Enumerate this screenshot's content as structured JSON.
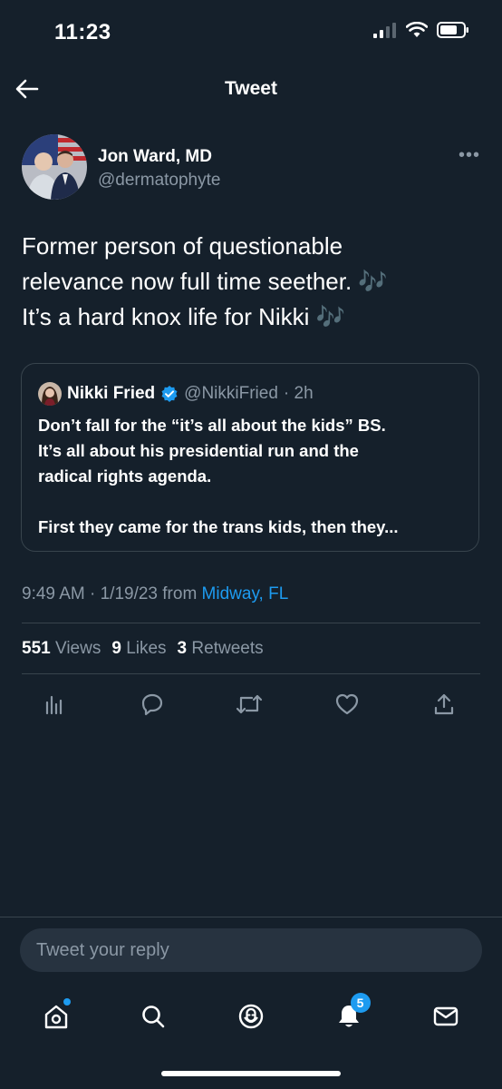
{
  "status_bar": {
    "time": "11:23"
  },
  "nav": {
    "title": "Tweet"
  },
  "tweet": {
    "author_name": "Jon Ward, MD",
    "author_handle": "@dermatophyte",
    "text_lines": [
      "Former person of questionable",
      "relevance now full time seether. 🎶",
      "It’s a hard knox life for Nikki 🎶"
    ]
  },
  "quote": {
    "name": "Nikki Fried",
    "handle": "@NikkiFried",
    "time": "· 2h",
    "text_lines": [
      "Don’t fall for the “it’s all about the kids” BS.",
      "It’s all about his presidential run and the",
      "radical rights agenda."
    ],
    "text_last": "First they came for the trans kids, then they..."
  },
  "meta": {
    "time": "9:49 AM · 1/19/23 from ",
    "location": "Midway, FL"
  },
  "stats": {
    "views_count": "551",
    "views_label": "Views",
    "likes_count": "9",
    "likes_label": "Likes",
    "retweets_count": "3",
    "retweets_label": "Retweets"
  },
  "reply": {
    "placeholder": "Tweet your reply"
  },
  "tabs": {
    "notifications_badge": "5"
  },
  "colors": {
    "background": "#15202b",
    "accent": "#1d9bf0",
    "secondary_text": "#8b98a5",
    "divider": "#38444d"
  },
  "icons": [
    "back-arrow-icon",
    "more-icon",
    "verified-icon",
    "analytics-icon",
    "reply-icon",
    "retweet-icon",
    "like-icon",
    "share-icon",
    "home-icon",
    "search-icon",
    "spaces-icon",
    "notifications-icon",
    "messages-icon"
  ]
}
